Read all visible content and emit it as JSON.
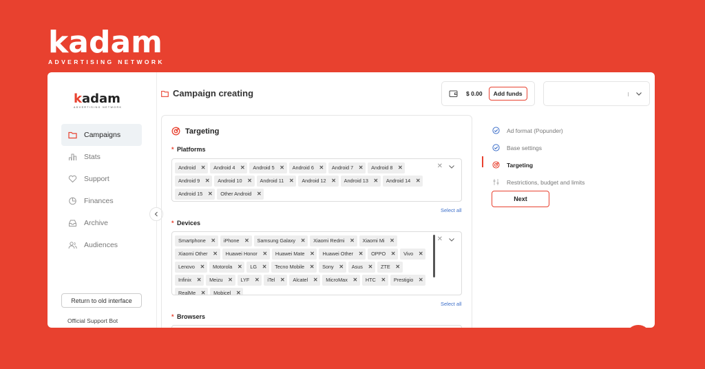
{
  "brand": {
    "logo": "kadam",
    "tagline": "ADVERTISING NETWORK"
  },
  "sidebar": {
    "logo_k": "k",
    "logo_rest": "adam",
    "logo_tag": "ADVERTISING NETWORK",
    "items": [
      {
        "label": "Campaigns",
        "icon": "folder-icon",
        "active": true
      },
      {
        "label": "Stats",
        "icon": "stats-icon",
        "active": false
      },
      {
        "label": "Support",
        "icon": "heart-icon",
        "active": false
      },
      {
        "label": "Finances",
        "icon": "pie-chart-icon",
        "active": false
      },
      {
        "label": "Archive",
        "icon": "archive-icon",
        "active": false
      },
      {
        "label": "Audiences",
        "icon": "users-icon",
        "active": false
      }
    ],
    "old_interface_label": "Return to old interface",
    "support_bot_label": "Official Support Bot"
  },
  "header": {
    "title": "Campaign creating",
    "balance": "$ 0.00",
    "add_funds_label": "Add funds"
  },
  "targeting": {
    "title": "Targeting",
    "platforms": {
      "label": "Platforms",
      "chips": [
        "Android",
        "Android 4",
        "Android 5",
        "Android 6",
        "Android 7",
        "Android 8",
        "Android 9",
        "Android 10",
        "Android 11",
        "Android 12",
        "Android 13",
        "Android 14",
        "Android 15",
        "Other Android"
      ],
      "select_all_label": "Select all"
    },
    "devices": {
      "label": "Devices",
      "chips": [
        "Smartphone",
        "iPhone",
        "Samsung Galaxy",
        "Xiaomi Redmi",
        "Xiaomi Mi",
        "Xiaomi Other",
        "Huawei Honor",
        "Huawei Mate",
        "Huawei Other",
        "OPPO",
        "Vivo",
        "Lenovo",
        "Motorola",
        "LG",
        "Tecno Mobile",
        "Sony",
        "Asus",
        "ZTE",
        "Infinix",
        "Meizu",
        "LYF",
        "iTel",
        "Alcatel",
        "MicroMax",
        "HTC",
        "Prestigio",
        "RealMe",
        "Mobicel"
      ],
      "select_all_label": "Select all"
    },
    "browsers": {
      "label": "Browsers"
    }
  },
  "steps": [
    {
      "label": "Ad format (Popunder)",
      "state": "done"
    },
    {
      "label": "Base settings",
      "state": "done"
    },
    {
      "label": "Targeting",
      "state": "active"
    },
    {
      "label": "Restrictions, budget and limits",
      "state": "pending"
    }
  ],
  "next_label": "Next",
  "colors": {
    "accent": "#e8412f",
    "link": "#3d6fc9",
    "check": "#3d6fc9"
  }
}
